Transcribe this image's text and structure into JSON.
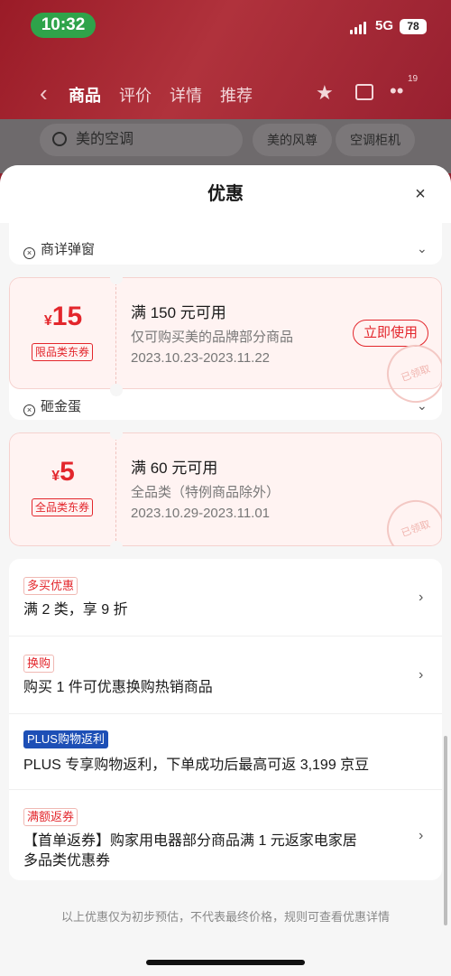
{
  "status": {
    "time": "10:32",
    "network": "5G",
    "battery": "78"
  },
  "nav": {
    "tabs": [
      "商品",
      "评价",
      "详情",
      "推荐"
    ],
    "cart_badge": "19"
  },
  "search": {
    "query": "美的空调",
    "chips": [
      "美的风尊",
      "空调柜机"
    ]
  },
  "sheet": {
    "title": "优惠",
    "close_glyph": "×"
  },
  "coupons": [
    {
      "footer_top": "商详弹窗"
    },
    {
      "currency": "¥",
      "amount": "15",
      "type_label": "限品类东券",
      "title": "满 150 元可用",
      "desc": "仅可购买美的品牌部分商品",
      "date": "2023.10.23-2023.11.22",
      "action": "立即使用",
      "stamp": "已领取",
      "footer": "砸金蛋"
    },
    {
      "currency": "¥",
      "amount": "5",
      "type_label": "全品类东券",
      "title": "满 60 元可用",
      "desc": "全品类（特例商品除外）",
      "date": "2023.10.29-2023.11.01",
      "stamp": "已领取"
    }
  ],
  "promotions": [
    {
      "tag": "多买优惠",
      "text": "满 2 类，享 9 折"
    },
    {
      "tag": "换购",
      "text": "购买 1 件可优惠换购热销商品"
    },
    {
      "tag": "PLUS购物返利",
      "text": "PLUS 专享购物返利，下单成功后最高可返 3,199 京豆"
    },
    {
      "tag": "满额返券",
      "text": "【首单返券】购家用电器部分商品满 1 元返家电家居多品类优惠券"
    }
  ],
  "disclaimer": "以上优惠仅为初步预估，不代表最终价格，规则可查看优惠详情",
  "colors": {
    "accent": "#e3262c",
    "plus_tag": "#1d4fb6",
    "header": "#9a1b27"
  }
}
